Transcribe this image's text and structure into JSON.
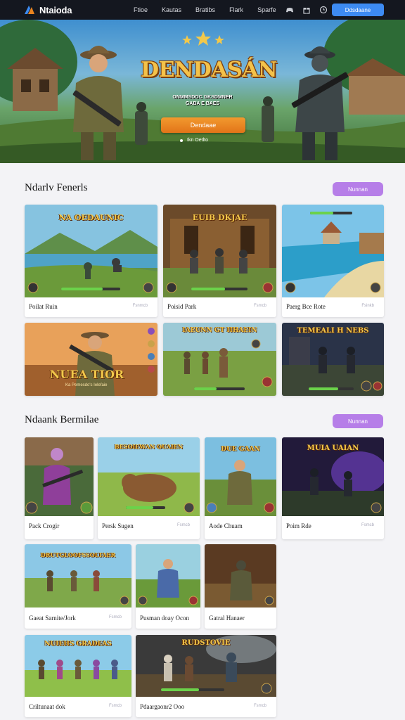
{
  "nav": {
    "logo": "Ntaioda",
    "links": [
      "Ftioe",
      "Kautas",
      "Bratibs",
      "Flark",
      "Sparfe"
    ],
    "cta": "Ddsdaane",
    "icons": [
      "controller-icon",
      "gift-icon",
      "clock-icon"
    ]
  },
  "hero": {
    "title": "DENDASÁN",
    "subtitle_line1": "ONMMSDOC GKSDMNER",
    "subtitle_line2": "GABA E BAES",
    "button": "Dendaae",
    "note": "Ikn Oetlto",
    "dots": 6,
    "active_dot": 1
  },
  "section1": {
    "title": "Ndarlv Fenerls",
    "button": "Nunnan",
    "cards": [
      {
        "title": "NA OEDAUNIC",
        "caption": "Poilat Ruin",
        "tag": "Fsnmcb"
      },
      {
        "title": "EUIB DKJAE",
        "caption": "Poisid Park",
        "tag": "Fsmcb"
      },
      {
        "title": "",
        "caption": "Paerg Bce Rote",
        "tag": "Fsinkb"
      },
      {
        "title": "NUEA TIOR",
        "subtitle": "Ka Pemesdo's Ielefaie",
        "caption": "",
        "tag": ""
      },
      {
        "title": "IAEUNN GT IIHAEIN",
        "caption": "",
        "tag": ""
      },
      {
        "title": "TEMEALI H NEBS",
        "caption": "",
        "tag": ""
      }
    ]
  },
  "section2": {
    "title": "Ndaank Bermilae",
    "button": "Nunnan",
    "cards": [
      {
        "title": "",
        "caption": "Pack Crogir",
        "tag": ""
      },
      {
        "title": "BESOIEWAN OUAIEN",
        "caption": "Persk Sugen",
        "tag": "Fsmcb"
      },
      {
        "title": "DUE GAAN",
        "caption": "Aode Chuam",
        "tag": ""
      },
      {
        "title": "MUIA UAIAN",
        "caption": "Poim Rde",
        "tag": "Fsmcb"
      },
      {
        "title": "DRUTGLOOFSSOLTAER",
        "caption": "Gaeat Sarnite/Jork",
        "tag": "Fsmcb"
      },
      {
        "title": "",
        "caption": "Pusman doay Ocon",
        "tag": ""
      },
      {
        "title": "",
        "caption": "Gatral Hanaer",
        "tag": ""
      },
      {
        "title": "NUIEHS GRADEAS",
        "caption": "Criltunaat dok",
        "tag": "Fsmcb"
      },
      {
        "title": "RUDSTOVIE",
        "caption": "Pdaargaonr2 Ooo",
        "tag": "Fsmcb"
      }
    ]
  },
  "colors": {
    "nav_bg": "#14171f",
    "accent_blue": "#3d8bf2",
    "accent_orange": "#e8831f",
    "pill_purple": "#b67ee8",
    "title_gold": "#f4c24a"
  }
}
